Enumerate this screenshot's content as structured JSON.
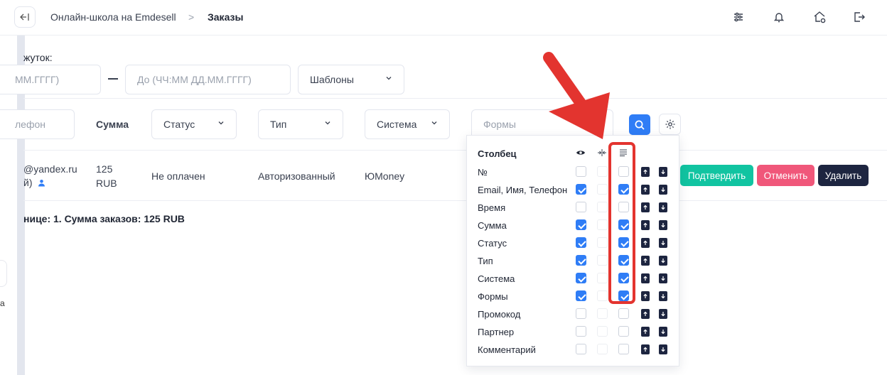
{
  "header": {
    "back_icon": "collapse-left-icon",
    "breadcrumb_parent": "Онлайн-школа на Emdesell",
    "breadcrumb_separator": ">",
    "breadcrumb_current": "Заказы",
    "icons": [
      "sliders-icon",
      "bell-icon",
      "home-gear-icon",
      "logout-icon"
    ]
  },
  "filters": {
    "period_label": "жуток:",
    "date_from_placeholder": "ММ.ГГГГ)",
    "date_to_placeholder": "До (ЧЧ:ММ ДД.ММ.ГГГГ)",
    "templates_label": "Шаблоны",
    "phone_placeholder": "лефон",
    "sum_column": "Сумма",
    "status_select": "Статус",
    "type_select": "Тип",
    "system_select": "Система",
    "forms_placeholder": "Формы"
  },
  "row": {
    "email": "@yandex.ru",
    "name_suffix": "й)",
    "amount": "125",
    "currency": "RUB",
    "status": "Не оплачен",
    "type": "Авторизованный",
    "system": "ЮMoney",
    "confirm_label": "Подтвердить",
    "cancel_label": "Отменить",
    "delete_label": "Удалить"
  },
  "footer": {
    "summary": "ницe: 1. Сумма заказов: 125 RUB"
  },
  "sidebar": {
    "letter": "а"
  },
  "columns_popup": {
    "header_label": "Столбец",
    "header_icons": [
      "eye-icon",
      "width-icon",
      "wrap-text-icon"
    ],
    "rows": [
      {
        "label": "№",
        "visible": false,
        "wrap": false
      },
      {
        "label": "Email, Имя, Телефон",
        "visible": true,
        "wrap": true
      },
      {
        "label": "Время",
        "visible": false,
        "wrap": false
      },
      {
        "label": "Сумма",
        "visible": true,
        "wrap": true
      },
      {
        "label": "Статус",
        "visible": true,
        "wrap": true
      },
      {
        "label": "Тип",
        "visible": true,
        "wrap": true
      },
      {
        "label": "Система",
        "visible": true,
        "wrap": true
      },
      {
        "label": "Формы",
        "visible": true,
        "wrap": true
      },
      {
        "label": "Промокод",
        "visible": false,
        "wrap": false
      },
      {
        "label": "Партнер",
        "visible": false,
        "wrap": false
      },
      {
        "label": "Комментарий",
        "visible": false,
        "wrap": false
      }
    ]
  },
  "colors": {
    "accent": "#2f7df6",
    "confirm": "#11c4a1",
    "cancel": "#f0577a",
    "delete": "#1d2540",
    "highlight": "#e3342f"
  }
}
